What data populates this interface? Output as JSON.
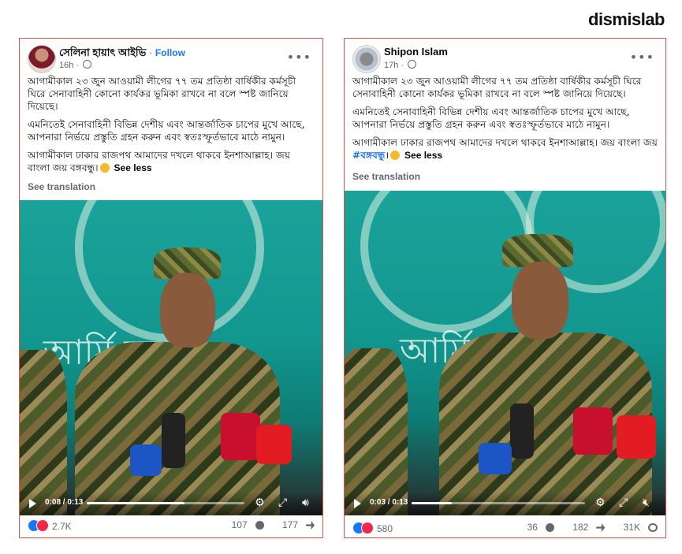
{
  "brand": "dismislab",
  "posts": [
    {
      "author": "সেলিনা হায়াৎ আইভি",
      "follow": "Follow",
      "time": "16h",
      "p1": "আগামীকাল ২৩ জুন আওয়ামী লীগের ৭৭ তম প্রতিষ্ঠা বার্ষিকীর কর্মসূচী ঘিরে সেনাবাহিনী কোনো কার্যকর ভূমিকা রাখবে না বলে স্পষ্ট জানিয়ে দিয়েছে।",
      "p2": "এমনিতেই সেনাবাহিনী বিভিন্ন দেশীয় এবং আন্তর্জাতিক চাপের মুখে আছে, আপনারা নির্ভয়ে প্রস্তুতি গ্রহন করুন এবং স্বতঃস্ফূর্তভাবে মাঠে নামুন।",
      "p3": "আগামীকাল ঢাকার রাজপথ আমাদের দখলে থাকবে ইনশাআল্লাহ। জয় বাংলা জয় বঙ্গবন্ধু।",
      "see_less": "See less",
      "see_translation": "See translation",
      "video_time": "0:08 / 0:13",
      "video_progress": 0.62,
      "reactions": "2.7K",
      "comments": "107",
      "shares": "177"
    },
    {
      "author": "Shipon Islam",
      "time": "17h",
      "p1": "আগামীকাল ২৩ জুন আওয়ামী লীগের ৭৭ তম প্রতিষ্ঠা বার্ষিকীর কর্মসূচী ঘিরে সেনাবাহিনী কোনো কার্যকর ভূমিকা রাখবে না বলে স্পষ্ট জানিয়ে দিয়েছে।",
      "p2": "এমনিতেই সেনাবাহিনী বিভিন্ন দেশীয় এবং আন্তর্জাতিক চাপের মুখে আছে, আপনারা নির্ভয়ে প্রস্তুতি গ্রহন করুন এবং স্বতঃস্ফূর্তভাবে মাঠে নামুন।",
      "p3": "আগামীকাল ঢাকার রাজপথ আমাদের দখলে থাকবে ইনশাআল্লাহ। জয় বাংলা জয় ",
      "hashtag": "#বঙ্গবন্ধু",
      "p3_end": "।",
      "see_less": "See less",
      "see_translation": "See translation",
      "video_time": "0:03 / 0:13",
      "video_progress": 0.23,
      "reactions": "580",
      "comments": "36",
      "shares": "182",
      "views": "31K"
    }
  ],
  "colors": {
    "link": "#1877f2",
    "border": "#d9534f",
    "video_bg": "#12978f"
  }
}
